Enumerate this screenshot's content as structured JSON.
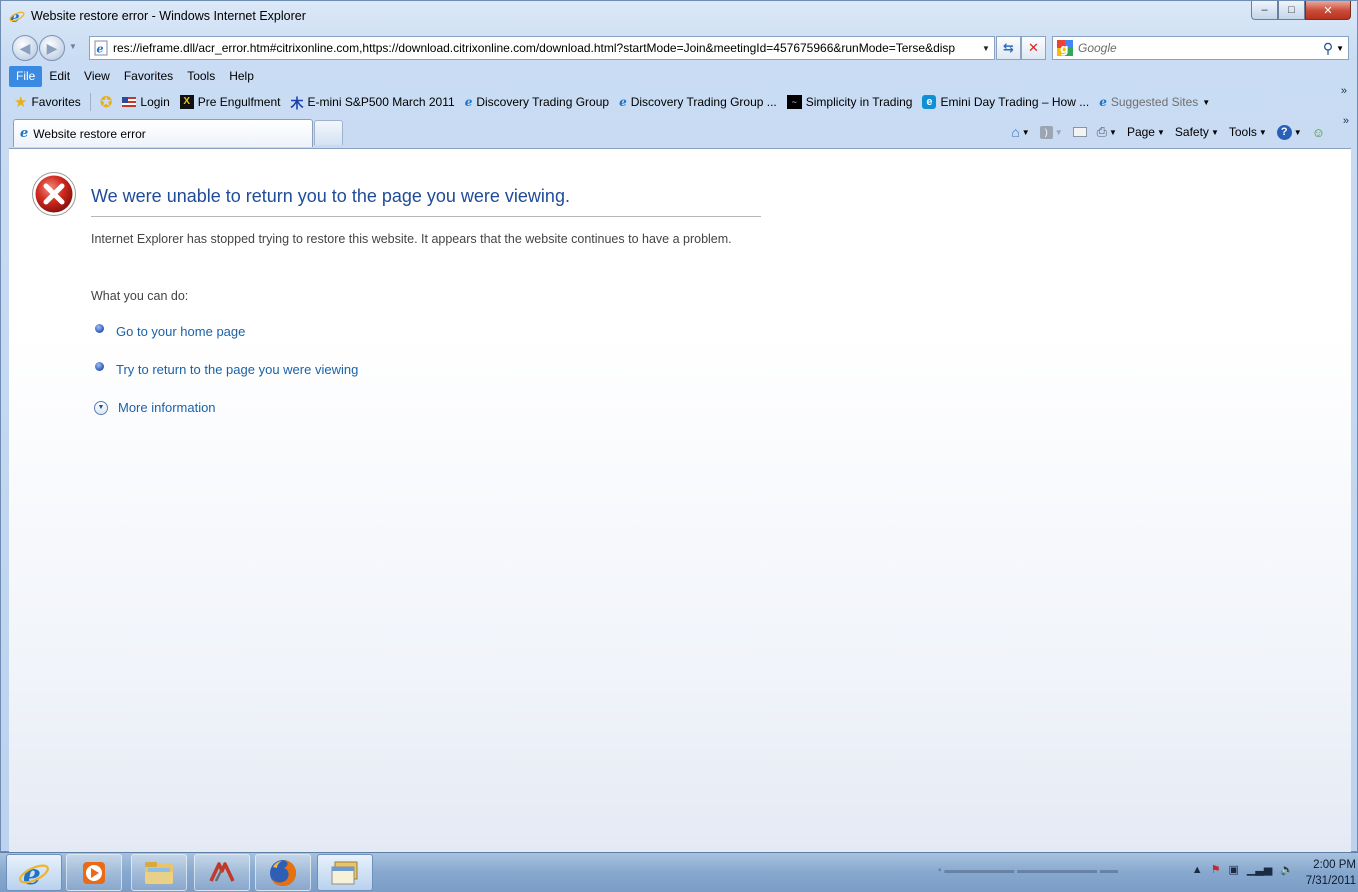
{
  "window": {
    "title": "Website restore error - Windows Internet Explorer",
    "controls": {
      "minimize": "–",
      "maximize": "□",
      "close": "✕"
    }
  },
  "address_bar": {
    "url": "res://ieframe.dll/acr_error.htm#citrixonline.com,https://download.citrixonline.com/download.html?startMode=Join&meetingId=457675966&runMode=Terse&disp"
  },
  "search": {
    "placeholder": "Google"
  },
  "menu": {
    "items": [
      "File",
      "Edit",
      "View",
      "Favorites",
      "Tools",
      "Help"
    ]
  },
  "favorites_bar": {
    "favorites_label": "Favorites",
    "items": [
      {
        "label": "Login"
      },
      {
        "label": "Pre Engulfment"
      },
      {
        "label": "E-mini S&P500 March 2011"
      },
      {
        "label": "Discovery Trading Group"
      },
      {
        "label": "Discovery Trading Group ..."
      },
      {
        "label": "Simplicity in Trading"
      },
      {
        "label": "Emini Day Trading – How ..."
      },
      {
        "label": "Suggested Sites"
      }
    ],
    "overflow": "»"
  },
  "tab": {
    "title": "Website restore error"
  },
  "command_bar": {
    "page": "Page",
    "safety": "Safety",
    "tools": "Tools"
  },
  "content": {
    "title": "We were unable to return you to the page you were viewing.",
    "description": "Internet Explorer has stopped trying to restore this website. It appears that the website continues to have a problem.",
    "what_you_can_do": "What you can do:",
    "actions": [
      {
        "label": "Go to your home page"
      },
      {
        "label": "Try to return to the page you were viewing"
      }
    ],
    "more_information": "More information"
  },
  "taskbar": {
    "clock_time": "2:00 PM",
    "clock_date": "7/31/2011"
  },
  "colors": {
    "accent": "#3a8ae3",
    "title_blue": "#1f4b99",
    "link_blue": "#1a62a8",
    "error_red": "#c62828"
  }
}
